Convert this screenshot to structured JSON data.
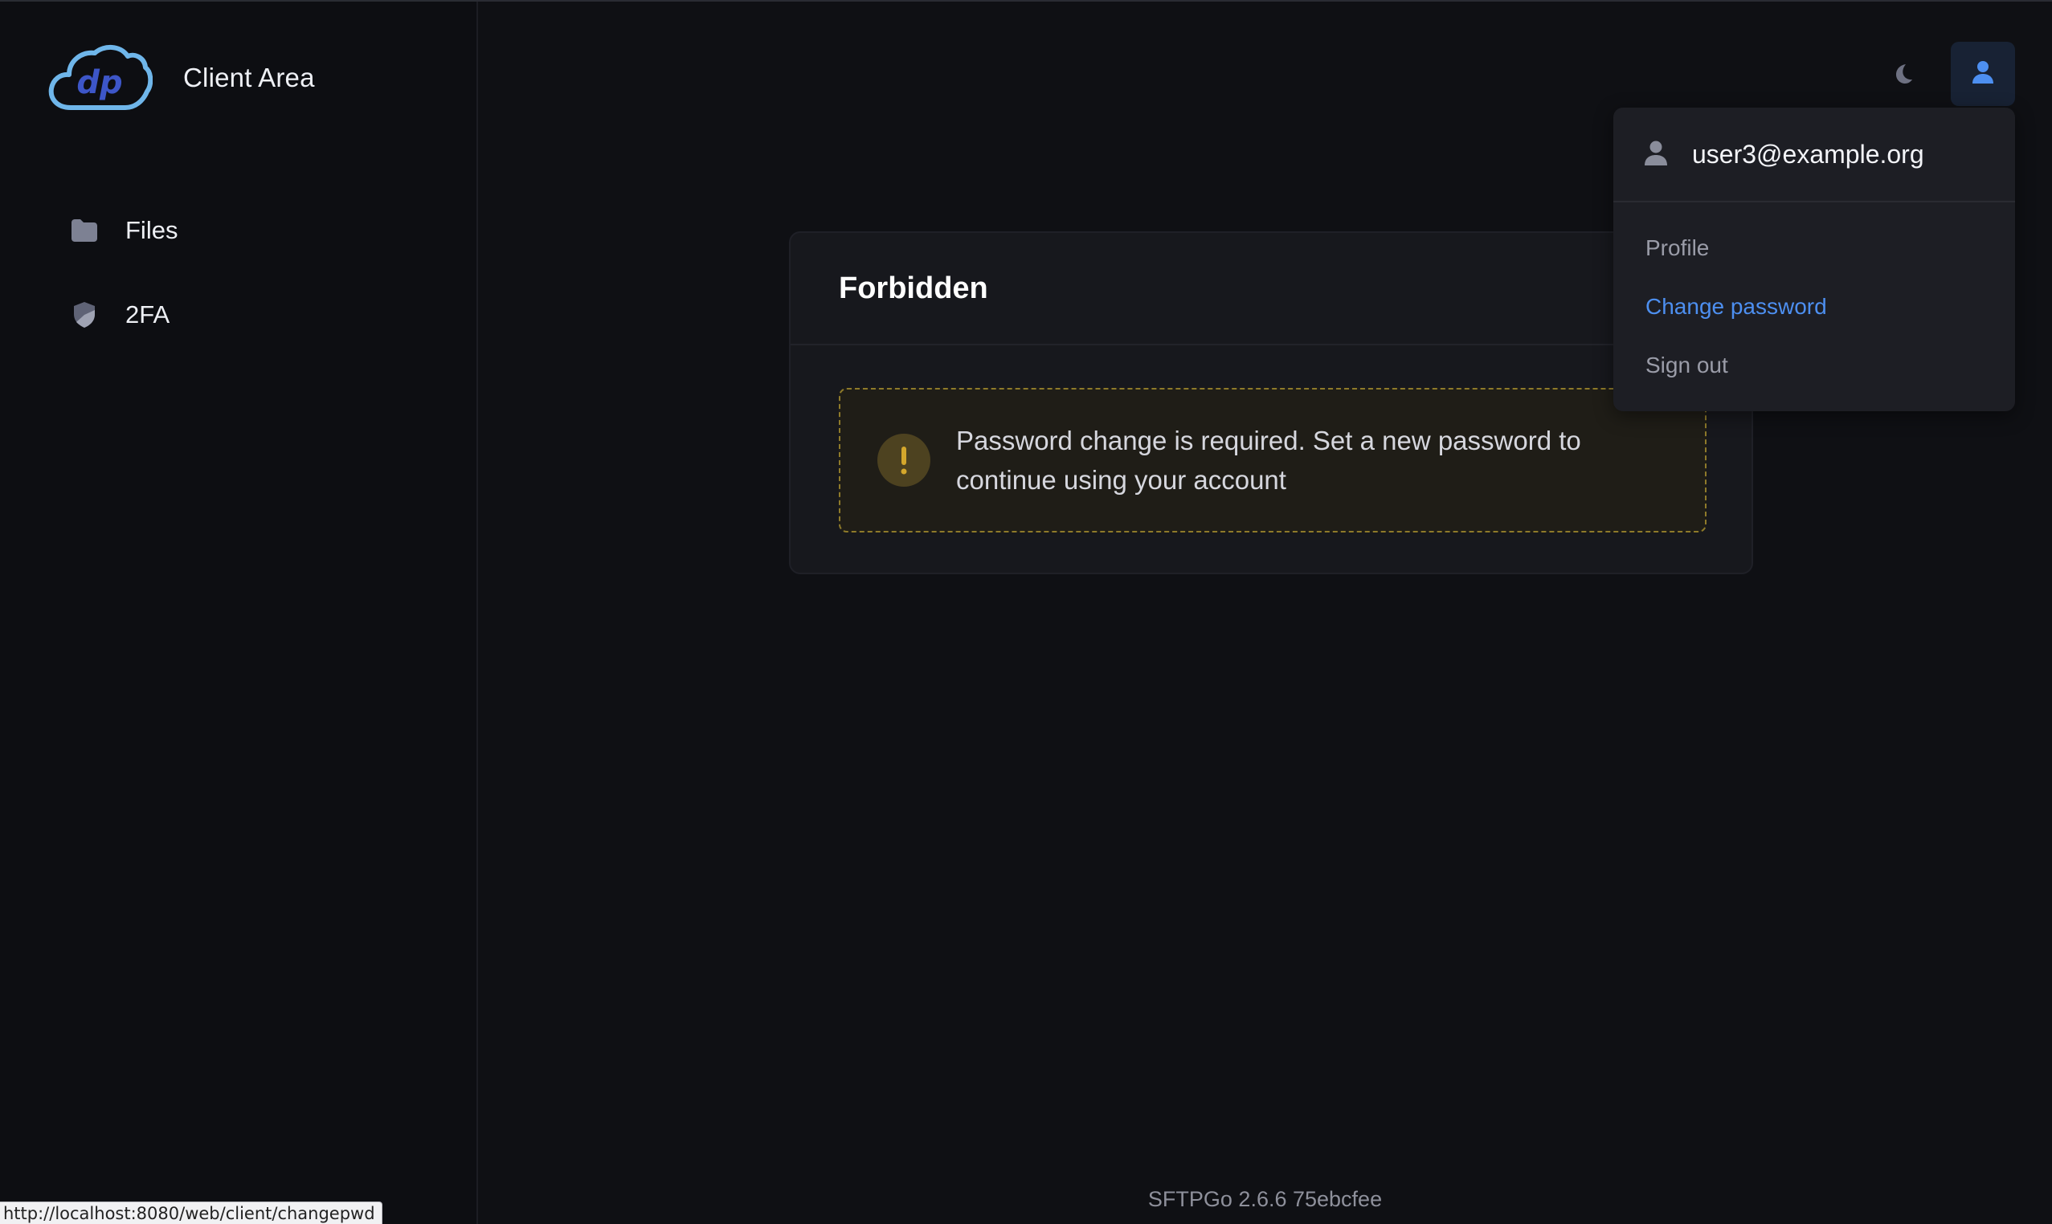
{
  "brand": {
    "title": "Client Area"
  },
  "sidebar": {
    "items": [
      {
        "label": "Files",
        "icon": "folder-icon"
      },
      {
        "label": "2FA",
        "icon": "shield-icon"
      }
    ]
  },
  "header": {
    "theme_icon": "moon-icon",
    "user_icon": "user-icon"
  },
  "card": {
    "title": "Forbidden",
    "alert": {
      "icon": "exclamation-icon",
      "message": "Password change is required. Set a new password to continue using your account"
    }
  },
  "user_menu": {
    "email": "user3@example.org",
    "items": [
      {
        "label": "Profile"
      },
      {
        "label": "Change password"
      },
      {
        "label": "Sign out"
      }
    ]
  },
  "footer": {
    "version": "SFTPGo 2.6.6 75ebcfee"
  },
  "status_bar": {
    "url": "http://localhost:8080/web/client/changepwd"
  },
  "colors": {
    "accent": "#4d8ff0",
    "warning": "#c9a227",
    "background": "#0f1014"
  }
}
